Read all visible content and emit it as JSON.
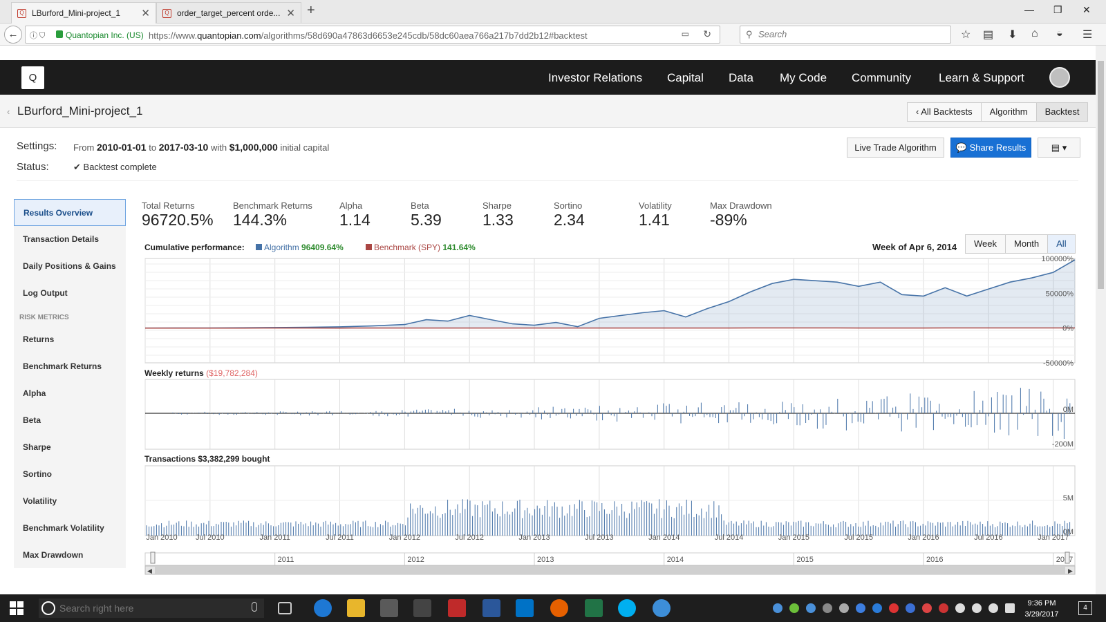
{
  "browser": {
    "tabs": [
      {
        "title": "LBurford_Mini-project_1",
        "active": true
      },
      {
        "title": "order_target_percent orde...",
        "active": false
      }
    ],
    "identity": "Quantopian Inc. (US)",
    "url_prefix": "https://www.",
    "url_domain": "quantopian.com",
    "url_path": "/algorithms/58d690a47863d6653e245cdb/58dc60aea766a217b7dd2b12#backtest",
    "search_placeholder": "Search"
  },
  "site": {
    "logo": "Q",
    "nav": [
      "Investor Relations",
      "Capital",
      "Data",
      "My Code",
      "Community",
      "Learn & Support"
    ]
  },
  "page": {
    "title": "LBurford_Mini-project_1",
    "tabs": [
      "All Backtests",
      "Algorithm",
      "Backtest"
    ],
    "settings_label": "Settings:",
    "status_label": "Status:",
    "settings": {
      "from_word": "From",
      "start": "2010-01-01",
      "to_word": "to",
      "end": "2017-03-10",
      "with_word": "with",
      "capital": "$1,000,000",
      "capital_suffix": "initial capital"
    },
    "status": "Backtest complete",
    "live_trade_label": "Live Trade Algorithm",
    "share_label": "Share Results"
  },
  "sidebar": {
    "items": [
      "Results Overview",
      "Transaction Details",
      "Daily Positions & Gains",
      "Log Output"
    ],
    "risk_header": "RISK METRICS",
    "risk_items": [
      "Returns",
      "Benchmark Returns",
      "Alpha",
      "Beta",
      "Sharpe",
      "Sortino",
      "Volatility",
      "Benchmark Volatility",
      "Max Drawdown"
    ]
  },
  "metrics": [
    {
      "label": "Total Returns",
      "value": "96720.5%"
    },
    {
      "label": "Benchmark Returns",
      "value": "144.3%"
    },
    {
      "label": "Alpha",
      "value": "1.14"
    },
    {
      "label": "Beta",
      "value": "5.39"
    },
    {
      "label": "Sharpe",
      "value": "1.33"
    },
    {
      "label": "Sortino",
      "value": "2.34"
    },
    {
      "label": "Volatility",
      "value": "1.41"
    },
    {
      "label": "Max Drawdown",
      "value": "-89%"
    }
  ],
  "chart_header": {
    "cumulative_label": "Cumulative performance:",
    "algo_legend": "Algorithm",
    "algo_value": "96409.64%",
    "bench_legend": "Benchmark (SPY)",
    "bench_value": "141.64%",
    "week_label": "Week of Apr 6, 2014",
    "range_buttons": [
      "Week",
      "Month",
      "All"
    ],
    "weekly_label": "Weekly returns",
    "weekly_value": "($19,782,284)",
    "transactions_label": "Transactions $3,382,299 bought"
  },
  "chart_data": [
    {
      "type": "area",
      "x": [
        "2010-01",
        "2010-04",
        "2010-07",
        "2010-10",
        "2011-01",
        "2011-04",
        "2011-07",
        "2011-10",
        "2012-01",
        "2012-03",
        "2012-05",
        "2012-07",
        "2012-09",
        "2012-11",
        "2013-01",
        "2013-03",
        "2013-05",
        "2013-07",
        "2013-09",
        "2013-11",
        "2014-01",
        "2014-03",
        "2014-05",
        "2014-07",
        "2014-09",
        "2014-11",
        "2015-01",
        "2015-03",
        "2015-05",
        "2015-07",
        "2015-09",
        "2015-11",
        "2016-01",
        "2016-03",
        "2016-05",
        "2016-07",
        "2016-09",
        "2016-11",
        "2017-01",
        "2017-03"
      ],
      "series": [
        {
          "name": "Algorithm",
          "color": "#4572a7",
          "values": [
            0,
            100,
            200,
            400,
            800,
            1200,
            1800,
            3000,
            5000,
            12000,
            10000,
            18000,
            12000,
            6000,
            4000,
            8000,
            2000,
            14000,
            18000,
            22000,
            25000,
            16000,
            28000,
            38000,
            52000,
            64000,
            70000,
            68000,
            66000,
            60000,
            66000,
            48000,
            46000,
            58000,
            46000,
            56000,
            66000,
            72000,
            80000,
            98000
          ]
        },
        {
          "name": "Benchmark (SPY)",
          "color": "#aa4643",
          "values": [
            0,
            5,
            5,
            10,
            20,
            25,
            15,
            20,
            40,
            50,
            45,
            55,
            60,
            65,
            70,
            80,
            85,
            90,
            95,
            100,
            105,
            110,
            112,
            115,
            118,
            120,
            122,
            120,
            118,
            115,
            112,
            110,
            112,
            120,
            125,
            130,
            135,
            138,
            140,
            141.64
          ]
        }
      ],
      "y_ticks": [
        "100000%",
        "50000%",
        "0%",
        "-50000%"
      ],
      "ylim": [
        -50000,
        100000
      ],
      "x_ticks": [
        "Jan 2010",
        "Jul 2010",
        "Jan 2011",
        "Jul 2011",
        "Jan 2012",
        "Jul 2012",
        "Jan 2013",
        "Jul 2013",
        "Jan 2014",
        "Jul 2014",
        "Jan 2015",
        "Jul 2015",
        "Jan 2016",
        "Jul 2016",
        "Jan 2017"
      ]
    },
    {
      "type": "bar",
      "title": "Weekly returns",
      "y_ticks": [
        "0M",
        "-200M"
      ],
      "ylim": [
        -200,
        0
      ]
    },
    {
      "type": "bar",
      "title": "Transactions $3,382,299 bought",
      "y_ticks": [
        "5M",
        "0M"
      ]
    }
  ],
  "navigator": {
    "years": [
      "2011",
      "2012",
      "2013",
      "2014",
      "2015",
      "2016",
      "2017"
    ]
  },
  "taskbar": {
    "search_placeholder": "Search right here",
    "time": "9:36 PM",
    "date": "3/29/2017",
    "notifications": "4"
  }
}
